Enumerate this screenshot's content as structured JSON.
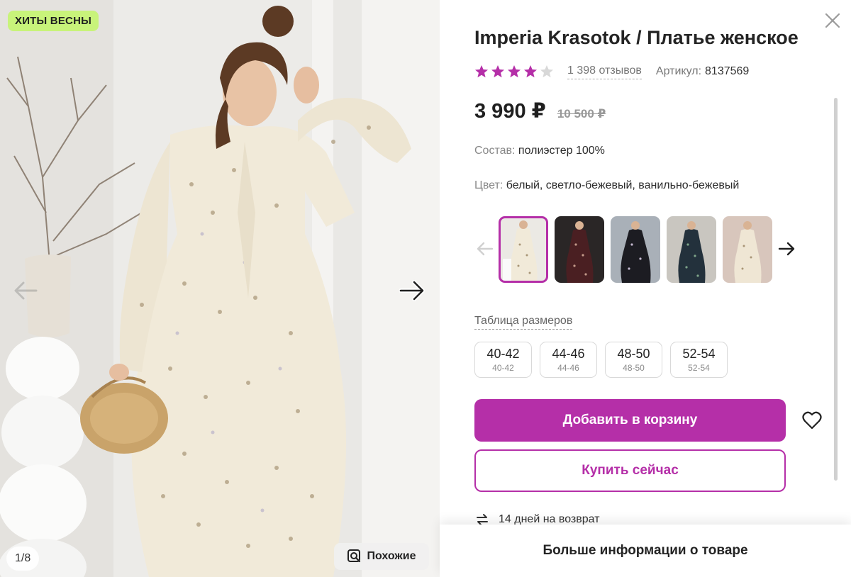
{
  "photo": {
    "badge": "ХИТЫ ВЕСНЫ",
    "counter": "1/8",
    "similar_label": "Похожие"
  },
  "product": {
    "title": "Imperia Krasotok / Платье женское",
    "rating": 4,
    "rating_max": 5,
    "reviews": "1 398 отзывов",
    "article_label": "Артикул:",
    "article_value": "8137569",
    "price": "3 990 ₽",
    "old_price": "10 500 ₽",
    "composition_label": "Состав:",
    "composition_value": "полиэстер 100%",
    "color_label": "Цвет:",
    "color_value": "белый, светло-бежевый, ванильно-бежевый"
  },
  "color_variants": [
    {
      "name": "cream-floral",
      "selected": true
    },
    {
      "name": "burgundy-floral",
      "selected": false
    },
    {
      "name": "black-floral",
      "selected": false
    },
    {
      "name": "navy-floral",
      "selected": false
    },
    {
      "name": "beige-floral",
      "selected": false
    }
  ],
  "sizes": {
    "table_link": "Таблица размеров",
    "items": [
      {
        "ru": "40-42",
        "eu": "40-42"
      },
      {
        "ru": "44-46",
        "eu": "44-46"
      },
      {
        "ru": "48-50",
        "eu": "48-50"
      },
      {
        "ru": "52-54",
        "eu": "52-54"
      }
    ]
  },
  "actions": {
    "add_to_cart": "Добавить в корзину",
    "buy_now": "Купить сейчас",
    "return_text": "14 дней на возврат",
    "more_info": "Больше информации о товаре"
  },
  "colors": {
    "accent": "#b52fa8",
    "badge_bg": "#c8f37a",
    "star_filled": "#b52fa8",
    "star_empty": "#d8d8d8"
  }
}
